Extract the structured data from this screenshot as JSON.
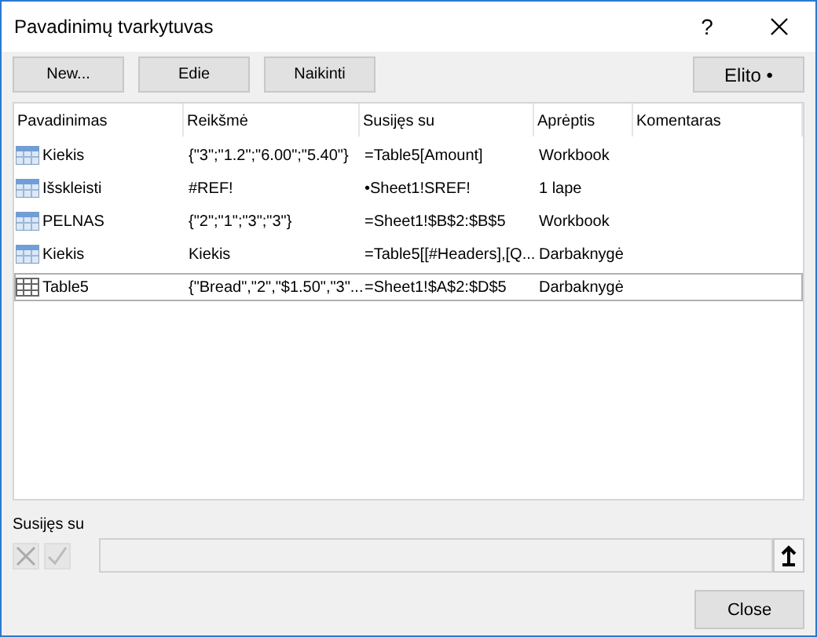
{
  "window": {
    "title": "Pavadinimų tvarkytuvas",
    "help": "?"
  },
  "buttons": [
    "New...",
    "Edie",
    "Naikinti"
  ],
  "filter_button": "Elito •",
  "columns": [
    "Pavadinimas",
    "Reikšmė",
    "Susijęs su",
    "Aprėptis",
    "Komentaras"
  ],
  "rows": [
    {
      "kind": "name",
      "selected": false,
      "cells": [
        "Kiekis",
        "{\"3\";\"1.2\";\"6.00\";\"5.40\"}",
        "=Table5[Amount]",
        "Workbook"
      ]
    },
    {
      "kind": "name",
      "selected": false,
      "cells": [
        "Išskleisti",
        "#REF!",
        "•Sheet1!SREF!",
        "1 lape"
      ]
    },
    {
      "kind": "name",
      "selected": false,
      "cells": [
        "PELNAS",
        "{\"2\";\"1\";\"3\";\"3\"}",
        "=Sheet1!$B$2:$B$5",
        "Workbook"
      ]
    },
    {
      "kind": "name",
      "selected": false,
      "cells": [
        "Kiekis",
        "Kiekis",
        "=Table5[[#Headers],[Q...",
        "Darbaknygė"
      ]
    },
    {
      "kind": "table",
      "selected": true,
      "cells": [
        "Table5",
        "{\"Bread\",\"2\",\"$1.50\",\"3\"...",
        "=Sheet1!$A$2:$D$5",
        "Darbaknygė"
      ]
    }
  ],
  "refers_to": {
    "label": "Susijęs su"
  },
  "close_button": "Close"
}
